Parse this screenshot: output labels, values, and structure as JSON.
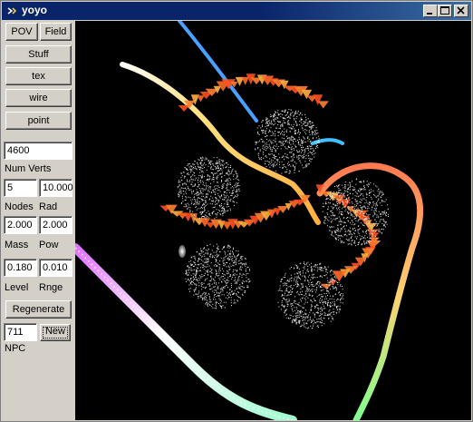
{
  "window": {
    "title": "yoyo",
    "icon": "app-icon"
  },
  "titlebar_buttons": [
    "minimize-icon",
    "maximize-icon",
    "close-icon"
  ],
  "sidebar": {
    "pov_label": "POV",
    "field_label": "Field",
    "stuff_label": "Stuff",
    "tex_label": "tex",
    "wire_label": "wire",
    "point_label": "point",
    "num_verts_value": "4600",
    "num_verts_label": "Num Verts",
    "nodes_value": "5",
    "rad_value": "10.000",
    "nodes_label": "Nodes",
    "rad_label": "Rad",
    "mass_value": "2.000",
    "pow_value": "2.000",
    "mass_label": "Mass",
    "pow_label": "Pow",
    "level_value": "0.180",
    "rnge_value": "0.010",
    "level_label": "Level",
    "rnge_label": "Rnge",
    "regenerate_label": "Regenerate",
    "npc_value": "711",
    "new_label": "New",
    "npc_label": "NPC"
  },
  "viewport": {
    "background": "#000000",
    "spheres": 5
  }
}
